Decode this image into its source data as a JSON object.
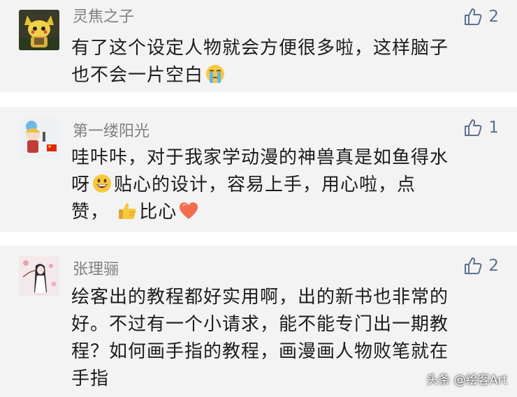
{
  "colors": {
    "card_background": "#f3f3f3",
    "name_text": "#7f7f7f",
    "like_accent": "#5b7094",
    "body_text": "#1c1c1c"
  },
  "comments": [
    {
      "author": "灵焦之子",
      "likes": "2",
      "text_lines": [
        "有了这个设定人物就会方便很多啦，这样脑子",
        "也不会一片空白"
      ],
      "emojis": [
        "crying-face-emoji"
      ]
    },
    {
      "author": "第一缕阳光",
      "likes": "1",
      "text_lines": [
        "哇咔咔，对于我家学动漫的神兽真是如鱼得水",
        "呀",
        "贴心的设计，容易上手，用心啦，点",
        "赞，",
        "比心"
      ],
      "emojis": [
        "grinning-face-emoji",
        "thumbs-up-emoji",
        "red-heart-emoji"
      ]
    },
    {
      "author": "张理骊",
      "likes": "2",
      "text_lines": [
        "绘客出的教程都好实用啊，出的新书也非常的",
        "好。不过有一个小请求，能不能专门出一期教",
        "程？如何画手指的教程，画漫画人物败笔就在",
        "手指"
      ],
      "emojis": []
    }
  ],
  "watermark": "头条 @绘客Art"
}
